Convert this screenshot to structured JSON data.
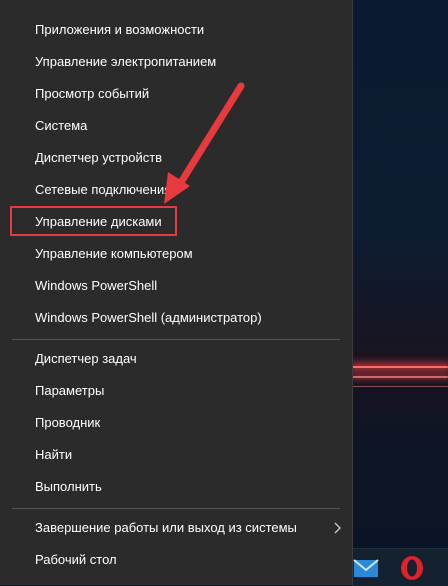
{
  "menu": {
    "items": [
      {
        "label": "Приложения и возможности"
      },
      {
        "label": "Управление электропитанием"
      },
      {
        "label": "Просмотр событий"
      },
      {
        "label": "Система"
      },
      {
        "label": "Диспетчер устройств"
      },
      {
        "label": "Сетевые подключения"
      },
      {
        "label": "Управление дисками"
      },
      {
        "label": "Управление компьютером"
      },
      {
        "label": "Windows PowerShell"
      },
      {
        "label": "Windows PowerShell (администратор)"
      },
      {
        "label": "Диспетчер задач"
      },
      {
        "label": "Параметры"
      },
      {
        "label": "Проводник"
      },
      {
        "label": "Найти"
      },
      {
        "label": "Выполнить"
      },
      {
        "label": "Завершение работы или выход из системы"
      },
      {
        "label": "Рабочий стол"
      }
    ]
  },
  "taskbar": {
    "icons": [
      "mail-icon",
      "opera-icon"
    ]
  },
  "colors": {
    "menu_bg": "#2b2b2b",
    "text": "#ffffff",
    "annotation": "#e8393e"
  }
}
